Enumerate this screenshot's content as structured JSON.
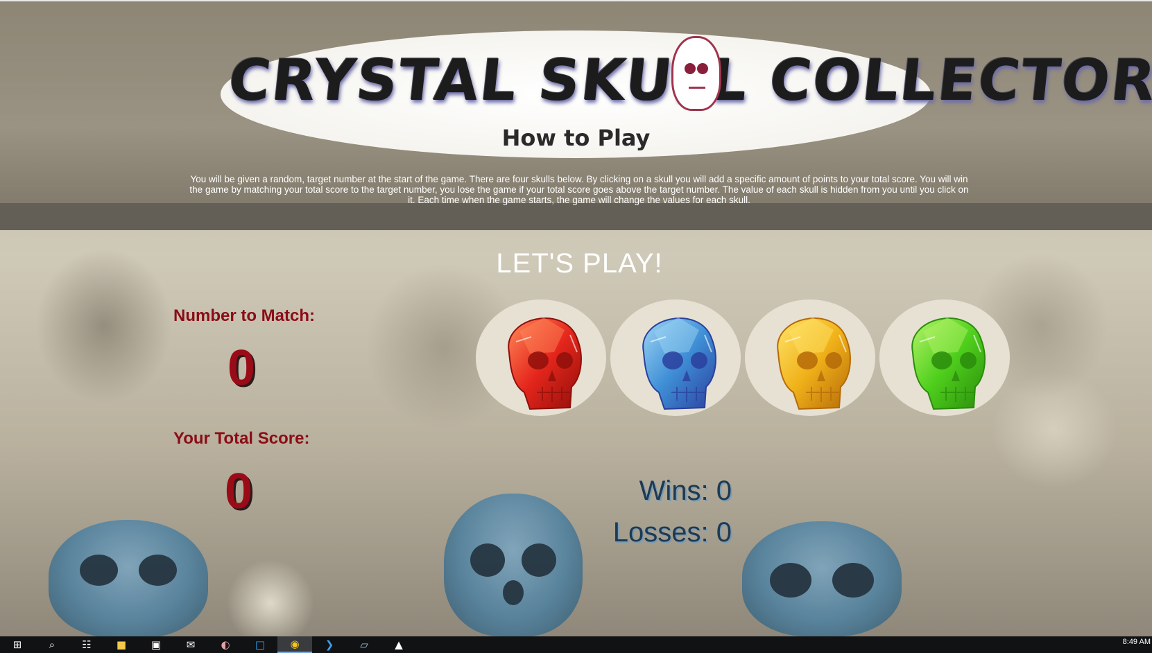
{
  "header": {
    "logo_text": "CRYSTAL SKULL COLLECTOR",
    "how_to_title": "How to Play",
    "instructions": "You will be given a random, target number at the start of the game. There are four skulls below. By clicking on a skull you will add a specific amount of points to your total score. You will win the game by matching your total score to the target number, you lose the game if your total score goes above the target number. The value of each skull is hidden from you until you click on it. Each time when the game starts, the game will change the values for each skull."
  },
  "game": {
    "heading": "LET'S PLAY!",
    "target_label": "Number to Match:",
    "target_value": "0",
    "score_label": "Your Total Score:",
    "score_value": "0",
    "wins_text": "Wins: 0",
    "losses_text": "Losses: 0",
    "skulls": [
      {
        "name": "red",
        "color": "#e5261c",
        "highlight": "#ff8a5a",
        "shade": "#8f0f0a"
      },
      {
        "name": "blue",
        "color": "#3f8fd6",
        "highlight": "#9fd6f5",
        "shade": "#2a3f9e"
      },
      {
        "name": "yellow",
        "color": "#f0b21a",
        "highlight": "#ffe46a",
        "shade": "#b56a08"
      },
      {
        "name": "green",
        "color": "#4fcf1c",
        "highlight": "#b6f46a",
        "shade": "#2a8c0c"
      }
    ]
  },
  "taskbar": {
    "icons": [
      "windows-start-icon",
      "search-icon",
      "task-view-icon",
      "file-explorer-icon",
      "store-icon",
      "mail-icon",
      "paint-icon",
      "photoshop-icon",
      "chrome-icon",
      "vscode-icon",
      "app-icon",
      "photos-icon"
    ],
    "clock": "8:49 AM"
  }
}
